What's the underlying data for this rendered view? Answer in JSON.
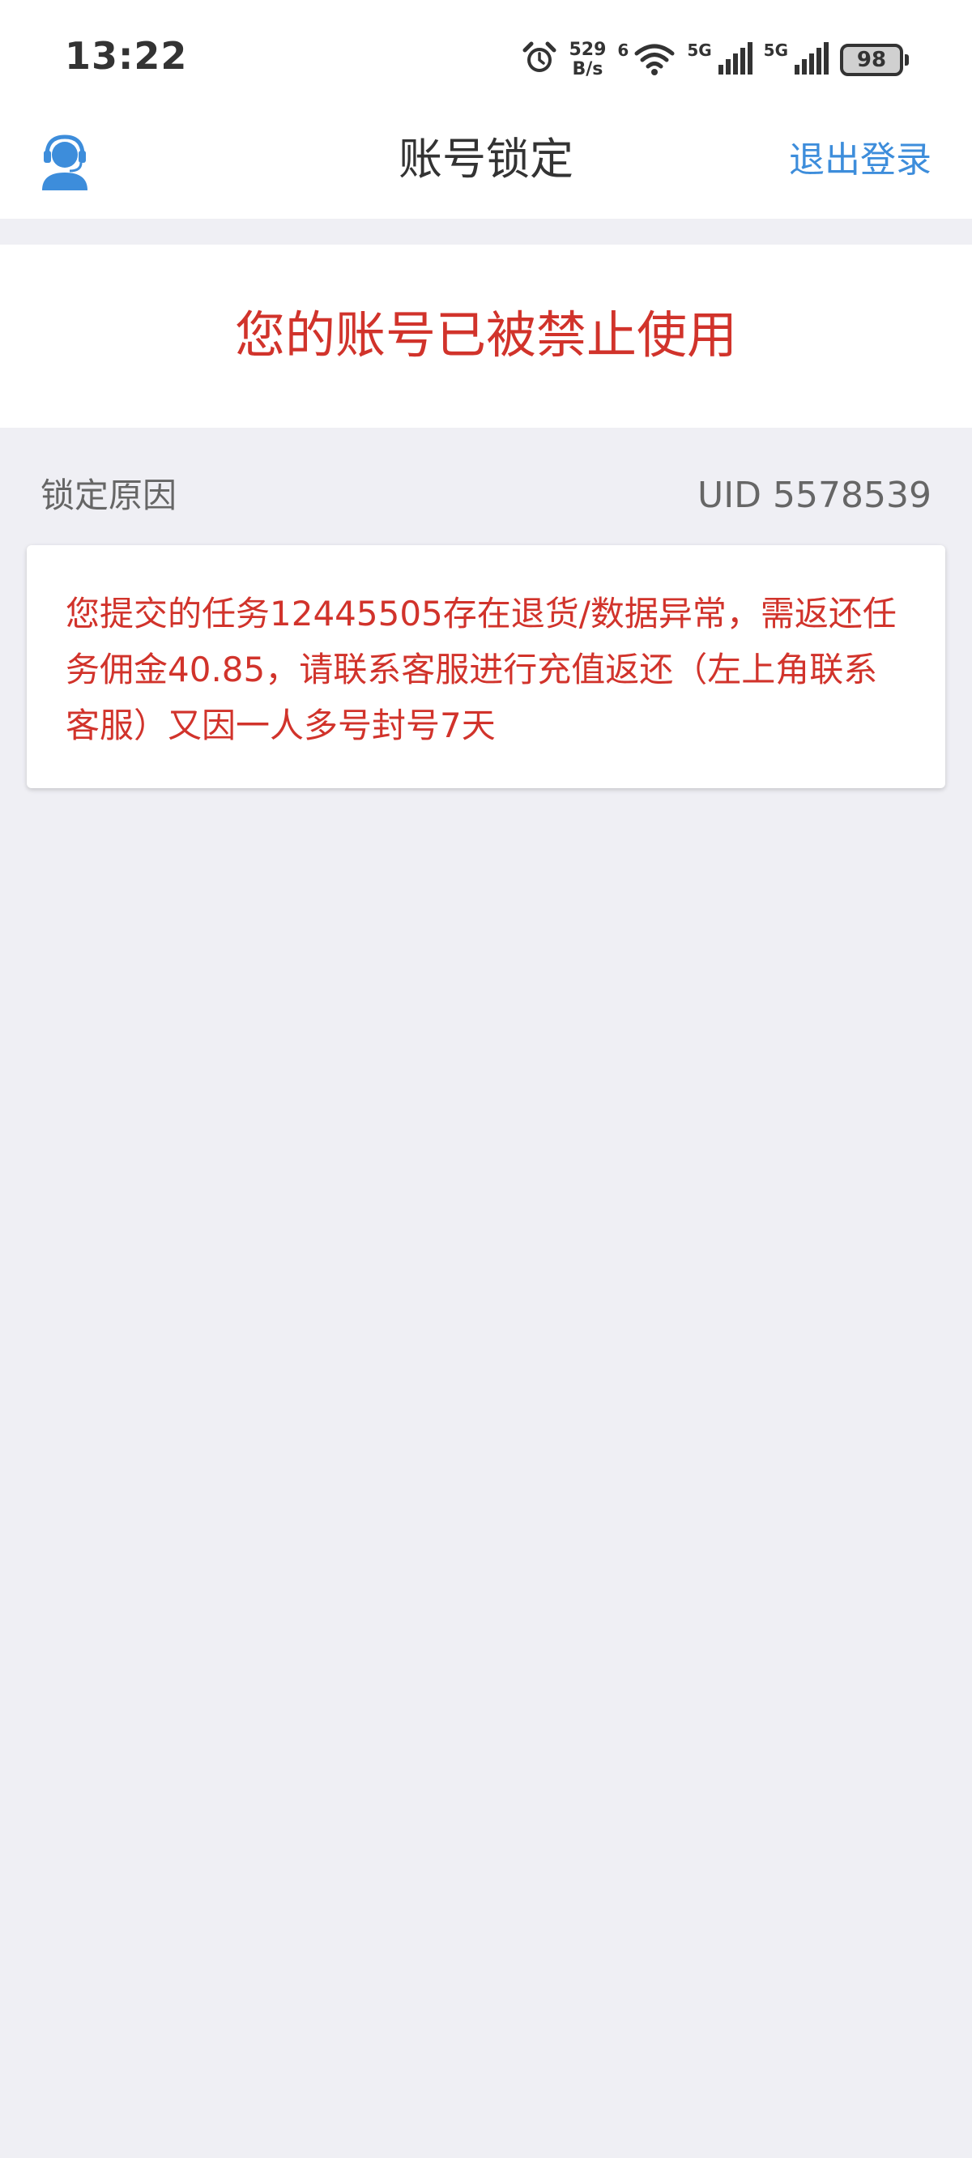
{
  "status_bar": {
    "time": "13:22",
    "net_speed_value": "529",
    "net_speed_unit": "B/s",
    "wifi_label": "6",
    "sim1_label": "5G",
    "sim2_label": "5G",
    "battery": "98"
  },
  "header": {
    "title": "账号锁定",
    "logout_label": "退出登录",
    "customer_service_icon": "customer-service-icon"
  },
  "banner": {
    "message": "您的账号已被禁止使用"
  },
  "reason_section": {
    "label": "锁定原因",
    "uid": "UID 5578539",
    "text": "您提交的任务12445505存在退货/数据异常，需返还任务佣金40.85，请联系客服进行充值返还（左上角联系客服）又因一人多号封号7天"
  },
  "colors": {
    "accent_blue": "#3d8ddb",
    "warning_red": "#d1332b",
    "page_background": "#efeff4"
  }
}
